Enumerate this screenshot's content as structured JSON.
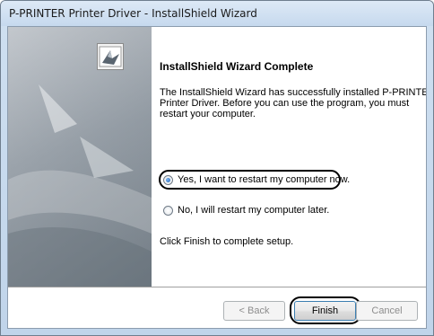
{
  "window": {
    "title": "P-PRINTER Printer Driver - InstallShield Wizard"
  },
  "content": {
    "heading": "InstallShield Wizard Complete",
    "description_lines": [
      "The InstallShield Wizard has successfully installed P-PRINTER",
      "Printer Driver.  Before you can use the program, you must",
      "restart your computer."
    ],
    "options": [
      {
        "label": "Yes, I want to restart my computer now.",
        "checked": true
      },
      {
        "label": "No, I will restart my computer later.",
        "checked": false
      }
    ],
    "finish_instruction": "Click Finish to complete setup."
  },
  "buttons": {
    "back": "< Back",
    "finish": "Finish",
    "cancel": "Cancel"
  },
  "icons": {
    "wizard": "installshield-wizard-icon"
  },
  "colors": {
    "titlebar": "#c6d9ee",
    "panel": "#8b949d",
    "radio_selected": "#1c63b8"
  }
}
